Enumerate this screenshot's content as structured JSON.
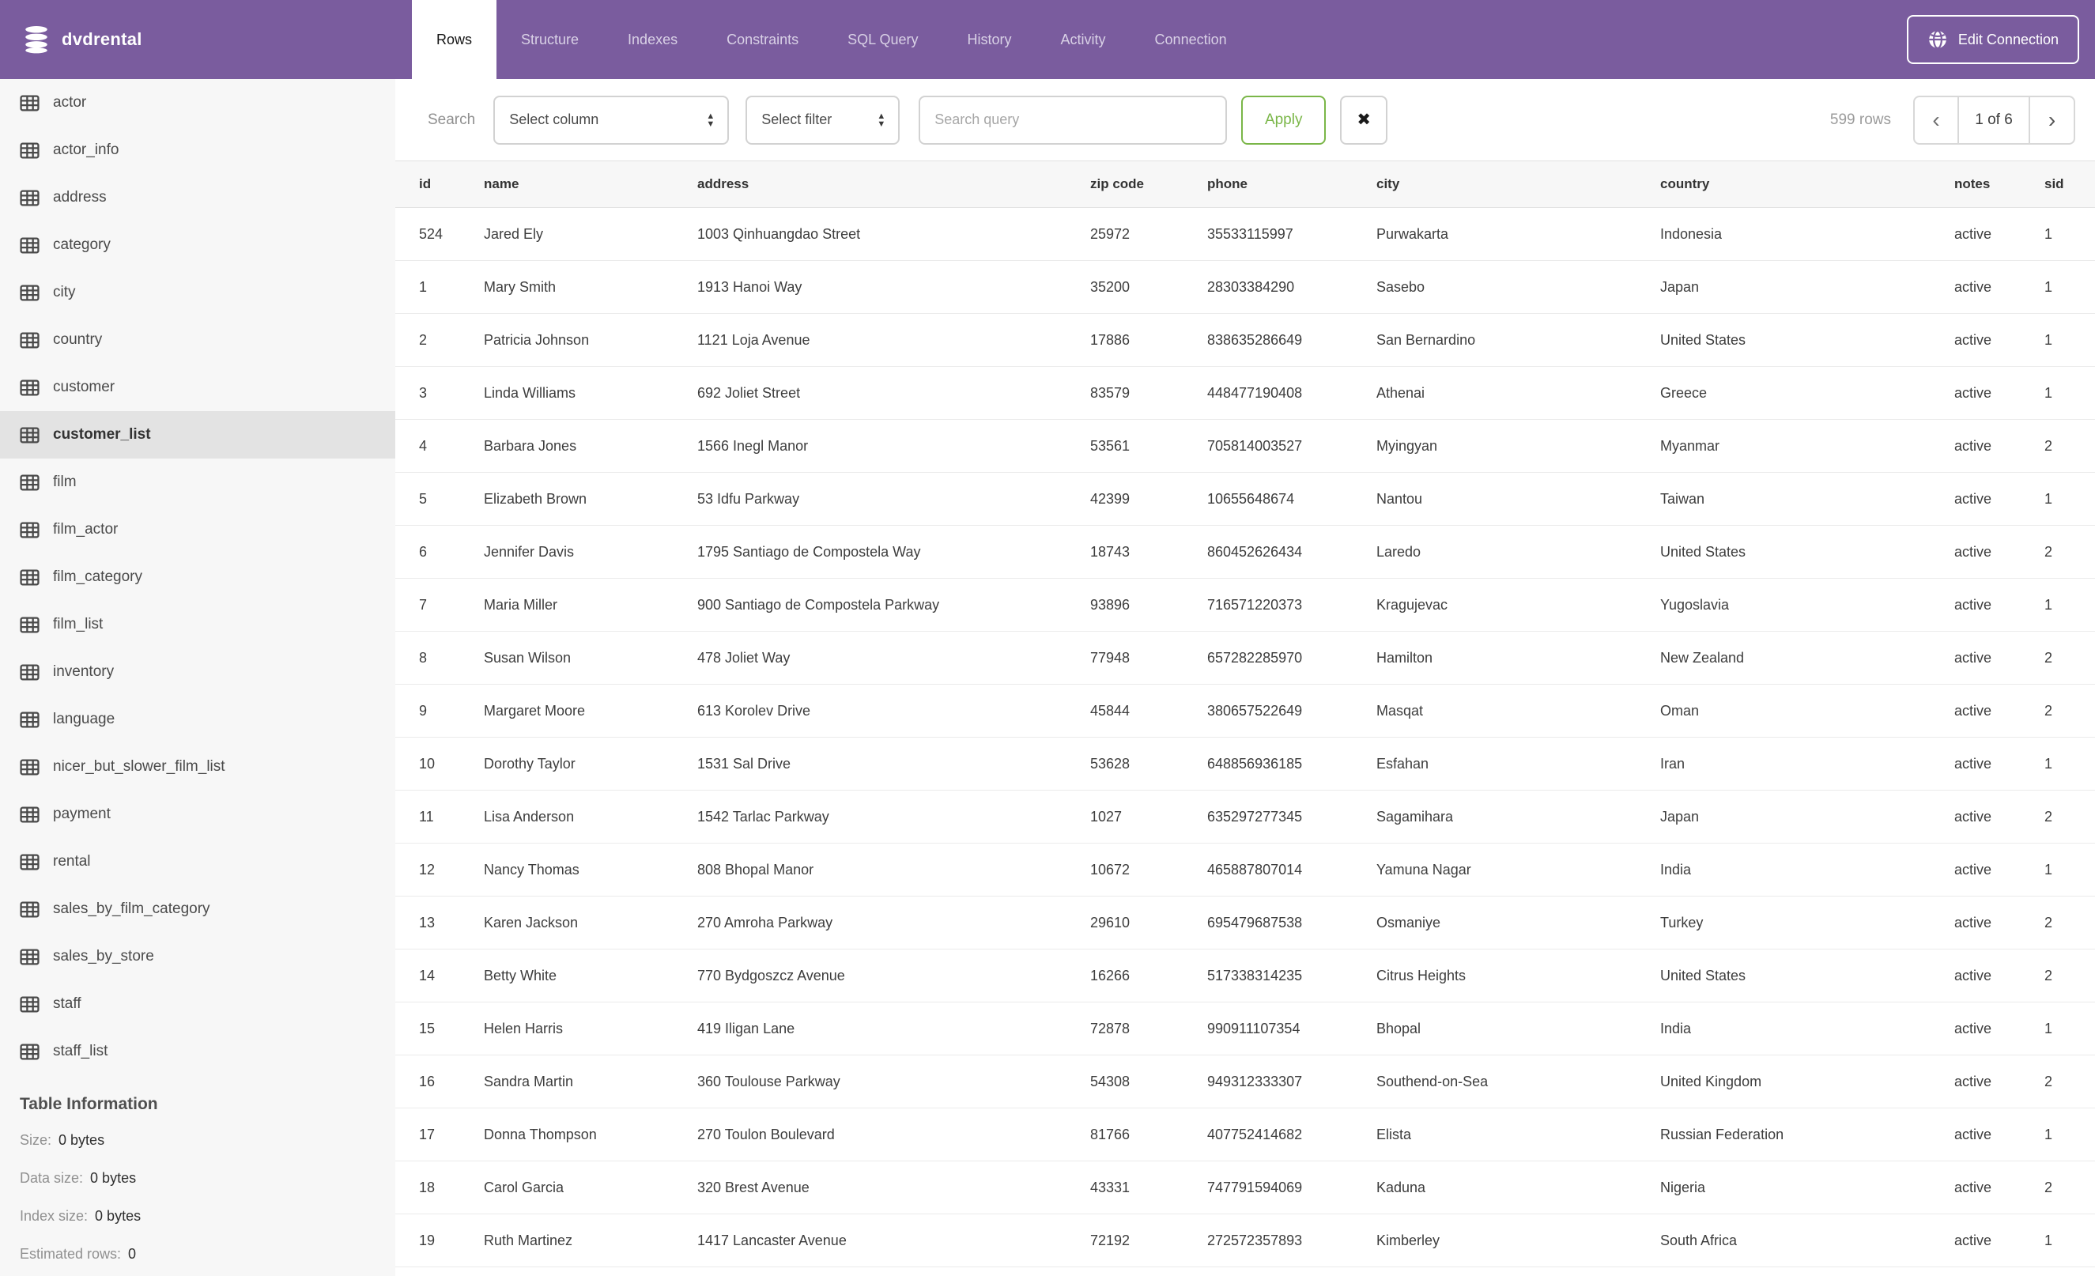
{
  "app": {
    "database": "dvdrental",
    "tabs": [
      "Rows",
      "Structure",
      "Indexes",
      "Constraints",
      "SQL Query",
      "History",
      "Activity",
      "Connection"
    ],
    "active_tab": "Rows",
    "edit_connection_label": "Edit Connection"
  },
  "colors": {
    "header_purple": "#7a5c9e",
    "apply_green": "#7ab648",
    "selected_item_bg": "#e3e3e3",
    "sidebar_bg": "#f7f7f7"
  },
  "sidebar": {
    "tables": [
      "actor",
      "actor_info",
      "address",
      "category",
      "city",
      "country",
      "customer",
      "customer_list",
      "film",
      "film_actor",
      "film_category",
      "film_list",
      "inventory",
      "language",
      "nicer_but_slower_film_list",
      "payment",
      "rental",
      "sales_by_film_category",
      "sales_by_store",
      "staff",
      "staff_list"
    ],
    "selected_table": "customer_list",
    "table_information": {
      "heading": "Table Information",
      "rows": [
        {
          "label": "Size:",
          "value": "0 bytes"
        },
        {
          "label": "Data size:",
          "value": "0 bytes"
        },
        {
          "label": "Index size:",
          "value": "0 bytes"
        },
        {
          "label": "Estimated rows:",
          "value": "0"
        }
      ]
    }
  },
  "toolbar": {
    "search_label": "Search",
    "column_select_value": "Select column",
    "filter_select_value": "Select filter",
    "query_placeholder": "Search query",
    "query_value": "",
    "apply_label": "Apply",
    "clear_label": "✖",
    "row_count": "599 rows",
    "pagination": {
      "prev": "‹",
      "current": "1 of 6",
      "next": "›"
    }
  },
  "table": {
    "columns": [
      "id",
      "name",
      "address",
      "zip code",
      "phone",
      "city",
      "country",
      "notes",
      "sid"
    ],
    "rows": [
      [
        "524",
        "Jared Ely",
        "1003 Qinhuangdao Street",
        "25972",
        "35533115997",
        "Purwakarta",
        "Indonesia",
        "active",
        "1"
      ],
      [
        "1",
        "Mary Smith",
        "1913 Hanoi Way",
        "35200",
        "28303384290",
        "Sasebo",
        "Japan",
        "active",
        "1"
      ],
      [
        "2",
        "Patricia Johnson",
        "1121 Loja Avenue",
        "17886",
        "838635286649",
        "San Bernardino",
        "United States",
        "active",
        "1"
      ],
      [
        "3",
        "Linda Williams",
        "692 Joliet Street",
        "83579",
        "448477190408",
        "Athenai",
        "Greece",
        "active",
        "1"
      ],
      [
        "4",
        "Barbara Jones",
        "1566 Inegl Manor",
        "53561",
        "705814003527",
        "Myingyan",
        "Myanmar",
        "active",
        "2"
      ],
      [
        "5",
        "Elizabeth Brown",
        "53 Idfu Parkway",
        "42399",
        "10655648674",
        "Nantou",
        "Taiwan",
        "active",
        "1"
      ],
      [
        "6",
        "Jennifer Davis",
        "1795 Santiago de Compostela Way",
        "18743",
        "860452626434",
        "Laredo",
        "United States",
        "active",
        "2"
      ],
      [
        "7",
        "Maria Miller",
        "900 Santiago de Compostela Parkway",
        "93896",
        "716571220373",
        "Kragujevac",
        "Yugoslavia",
        "active",
        "1"
      ],
      [
        "8",
        "Susan Wilson",
        "478 Joliet Way",
        "77948",
        "657282285970",
        "Hamilton",
        "New Zealand",
        "active",
        "2"
      ],
      [
        "9",
        "Margaret Moore",
        "613 Korolev Drive",
        "45844",
        "380657522649",
        "Masqat",
        "Oman",
        "active",
        "2"
      ],
      [
        "10",
        "Dorothy Taylor",
        "1531 Sal Drive",
        "53628",
        "648856936185",
        "Esfahan",
        "Iran",
        "active",
        "1"
      ],
      [
        "11",
        "Lisa Anderson",
        "1542 Tarlac Parkway",
        "1027",
        "635297277345",
        "Sagamihara",
        "Japan",
        "active",
        "2"
      ],
      [
        "12",
        "Nancy Thomas",
        "808 Bhopal Manor",
        "10672",
        "465887807014",
        "Yamuna Nagar",
        "India",
        "active",
        "1"
      ],
      [
        "13",
        "Karen Jackson",
        "270 Amroha Parkway",
        "29610",
        "695479687538",
        "Osmaniye",
        "Turkey",
        "active",
        "2"
      ],
      [
        "14",
        "Betty White",
        "770 Bydgoszcz Avenue",
        "16266",
        "517338314235",
        "Citrus Heights",
        "United States",
        "active",
        "2"
      ],
      [
        "15",
        "Helen Harris",
        "419 Iligan Lane",
        "72878",
        "990911107354",
        "Bhopal",
        "India",
        "active",
        "1"
      ],
      [
        "16",
        "Sandra Martin",
        "360 Toulouse Parkway",
        "54308",
        "949312333307",
        "Southend-on-Sea",
        "United Kingdom",
        "active",
        "2"
      ],
      [
        "17",
        "Donna Thompson",
        "270 Toulon Boulevard",
        "81766",
        "407752414682",
        "Elista",
        "Russian Federation",
        "active",
        "1"
      ],
      [
        "18",
        "Carol Garcia",
        "320 Brest Avenue",
        "43331",
        "747791594069",
        "Kaduna",
        "Nigeria",
        "active",
        "2"
      ],
      [
        "19",
        "Ruth Martinez",
        "1417 Lancaster Avenue",
        "72192",
        "272572357893",
        "Kimberley",
        "South Africa",
        "active",
        "1"
      ]
    ]
  }
}
